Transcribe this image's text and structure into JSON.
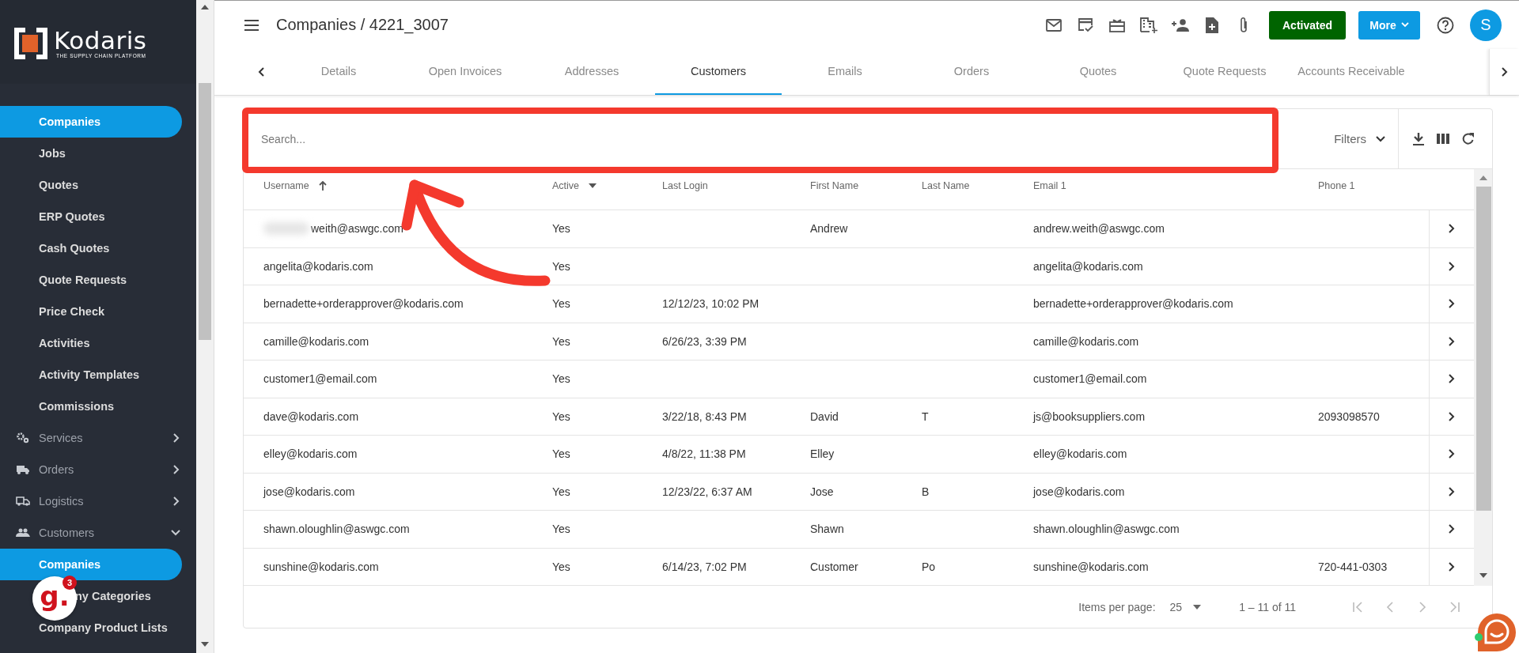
{
  "sidebar": {
    "logo": {
      "name": "Kodaris",
      "tagline": "THE SUPPLY CHAIN PLATFORM"
    },
    "items": [
      {
        "kind": "link",
        "label": "Companies",
        "selected": true
      },
      {
        "kind": "link",
        "label": "Jobs",
        "selected": false
      },
      {
        "kind": "link",
        "label": "Quotes",
        "selected": false
      },
      {
        "kind": "link",
        "label": "ERP Quotes",
        "selected": false
      },
      {
        "kind": "link",
        "label": "Cash Quotes",
        "selected": false
      },
      {
        "kind": "link",
        "label": "Quote Requests",
        "selected": false
      },
      {
        "kind": "link",
        "label": "Price Check",
        "selected": false
      },
      {
        "kind": "link",
        "label": "Activities",
        "selected": false
      },
      {
        "kind": "link",
        "label": "Activity Templates",
        "selected": false
      },
      {
        "kind": "link",
        "label": "Commissions",
        "selected": false
      },
      {
        "kind": "section",
        "label": "Services",
        "selected": false,
        "expanded": false
      },
      {
        "kind": "section",
        "label": "Orders",
        "selected": false,
        "expanded": false
      },
      {
        "kind": "section",
        "label": "Logistics",
        "selected": false,
        "expanded": false
      },
      {
        "kind": "section",
        "label": "Customers",
        "selected": false,
        "expanded": true
      },
      {
        "kind": "link",
        "label": "Companies",
        "selected": true
      },
      {
        "kind": "covered",
        "label": "ny Categories",
        "selected": false
      },
      {
        "kind": "link",
        "label": "Company Product Lists",
        "selected": false
      }
    ]
  },
  "guide_badge": {
    "letter": "g.",
    "count": "3"
  },
  "header": {
    "title": "Companies / 4221_3007",
    "status_button": "Activated",
    "more_button": "More",
    "avatar": "S"
  },
  "tabs": [
    {
      "label": "Details",
      "selected": false
    },
    {
      "label": "Open Invoices",
      "selected": false
    },
    {
      "label": "Addresses",
      "selected": false
    },
    {
      "label": "Customers",
      "selected": true
    },
    {
      "label": "Emails",
      "selected": false
    },
    {
      "label": "Orders",
      "selected": false
    },
    {
      "label": "Quotes",
      "selected": false
    },
    {
      "label": "Quote Requests",
      "selected": false
    },
    {
      "label": "Accounts Receivable",
      "selected": false
    }
  ],
  "search": {
    "placeholder": "Search..."
  },
  "filters": "Filters",
  "table": {
    "columns": [
      {
        "label": "Username",
        "sorted": true,
        "menu": false
      },
      {
        "label": "Active",
        "sorted": false,
        "menu": true
      },
      {
        "label": "Last Login",
        "sorted": false,
        "menu": false
      },
      {
        "label": "First Name",
        "sorted": false,
        "menu": false
      },
      {
        "label": "Last Name",
        "sorted": false,
        "menu": false
      },
      {
        "label": "Email 1",
        "sorted": false,
        "menu": false
      },
      {
        "label": "Phone 1",
        "sorted": false,
        "menu": false
      }
    ],
    "rows": [
      {
        "redacted": true,
        "cells": [
          "weith@aswgc.com",
          "Yes",
          "",
          "Andrew",
          "",
          "andrew.weith@aswgc.com",
          ""
        ]
      },
      {
        "redacted": false,
        "cells": [
          "angelita@kodaris.com",
          "Yes",
          "",
          "",
          "",
          "angelita@kodaris.com",
          ""
        ]
      },
      {
        "redacted": false,
        "cells": [
          "bernadette+orderapprover@kodaris.com",
          "Yes",
          "12/12/23, 10:02 PM",
          "",
          "",
          "bernadette+orderapprover@kodaris.com",
          ""
        ]
      },
      {
        "redacted": false,
        "cells": [
          "camille@kodaris.com",
          "Yes",
          "6/26/23, 3:39 PM",
          "",
          "",
          "camille@kodaris.com",
          ""
        ]
      },
      {
        "redacted": false,
        "cells": [
          "customer1@email.com",
          "Yes",
          "",
          "",
          "",
          "customer1@email.com",
          ""
        ]
      },
      {
        "redacted": false,
        "cells": [
          "dave@kodaris.com",
          "Yes",
          "3/22/18, 8:43 PM",
          "David",
          "T",
          "js@booksuppliers.com",
          "2093098570"
        ]
      },
      {
        "redacted": false,
        "cells": [
          "elley@kodaris.com",
          "Yes",
          "4/8/22, 11:38 PM",
          "Elley",
          "",
          "elley@kodaris.com",
          ""
        ]
      },
      {
        "redacted": false,
        "cells": [
          "jose@kodaris.com",
          "Yes",
          "12/23/22, 6:37 AM",
          "Jose",
          "B",
          "jose@kodaris.com",
          ""
        ]
      },
      {
        "redacted": false,
        "cells": [
          "shawn.oloughlin@aswgc.com",
          "Yes",
          "",
          "Shawn",
          "",
          "shawn.oloughlin@aswgc.com",
          ""
        ]
      },
      {
        "redacted": false,
        "cells": [
          "sunshine@kodaris.com",
          "Yes",
          "6/14/23, 7:02 PM",
          "Customer",
          "Po",
          "sunshine@kodaris.com",
          "720-441-0303"
        ]
      }
    ]
  },
  "pagination": {
    "items_per_page_label": "Items per page:",
    "page_size": "25",
    "range": "1 – 11 of 11",
    "buttons": [
      {
        "disabled": true
      },
      {
        "disabled": true
      },
      {
        "disabled": true
      },
      {
        "disabled": true
      }
    ]
  }
}
